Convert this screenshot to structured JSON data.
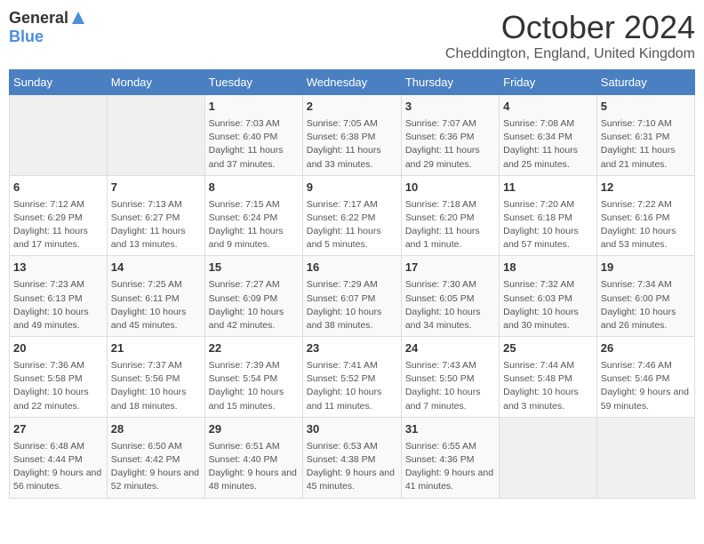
{
  "logo": {
    "general": "General",
    "blue": "Blue"
  },
  "title": "October 2024",
  "location": "Cheddington, England, United Kingdom",
  "days_of_week": [
    "Sunday",
    "Monday",
    "Tuesday",
    "Wednesday",
    "Thursday",
    "Friday",
    "Saturday"
  ],
  "weeks": [
    [
      {
        "day": "",
        "info": ""
      },
      {
        "day": "",
        "info": ""
      },
      {
        "day": "1",
        "sunrise": "Sunrise: 7:03 AM",
        "sunset": "Sunset: 6:40 PM",
        "daylight": "Daylight: 11 hours and 37 minutes."
      },
      {
        "day": "2",
        "sunrise": "Sunrise: 7:05 AM",
        "sunset": "Sunset: 6:38 PM",
        "daylight": "Daylight: 11 hours and 33 minutes."
      },
      {
        "day": "3",
        "sunrise": "Sunrise: 7:07 AM",
        "sunset": "Sunset: 6:36 PM",
        "daylight": "Daylight: 11 hours and 29 minutes."
      },
      {
        "day": "4",
        "sunrise": "Sunrise: 7:08 AM",
        "sunset": "Sunset: 6:34 PM",
        "daylight": "Daylight: 11 hours and 25 minutes."
      },
      {
        "day": "5",
        "sunrise": "Sunrise: 7:10 AM",
        "sunset": "Sunset: 6:31 PM",
        "daylight": "Daylight: 11 hours and 21 minutes."
      }
    ],
    [
      {
        "day": "6",
        "sunrise": "Sunrise: 7:12 AM",
        "sunset": "Sunset: 6:29 PM",
        "daylight": "Daylight: 11 hours and 17 minutes."
      },
      {
        "day": "7",
        "sunrise": "Sunrise: 7:13 AM",
        "sunset": "Sunset: 6:27 PM",
        "daylight": "Daylight: 11 hours and 13 minutes."
      },
      {
        "day": "8",
        "sunrise": "Sunrise: 7:15 AM",
        "sunset": "Sunset: 6:24 PM",
        "daylight": "Daylight: 11 hours and 9 minutes."
      },
      {
        "day": "9",
        "sunrise": "Sunrise: 7:17 AM",
        "sunset": "Sunset: 6:22 PM",
        "daylight": "Daylight: 11 hours and 5 minutes."
      },
      {
        "day": "10",
        "sunrise": "Sunrise: 7:18 AM",
        "sunset": "Sunset: 6:20 PM",
        "daylight": "Daylight: 11 hours and 1 minute."
      },
      {
        "day": "11",
        "sunrise": "Sunrise: 7:20 AM",
        "sunset": "Sunset: 6:18 PM",
        "daylight": "Daylight: 10 hours and 57 minutes."
      },
      {
        "day": "12",
        "sunrise": "Sunrise: 7:22 AM",
        "sunset": "Sunset: 6:16 PM",
        "daylight": "Daylight: 10 hours and 53 minutes."
      }
    ],
    [
      {
        "day": "13",
        "sunrise": "Sunrise: 7:23 AM",
        "sunset": "Sunset: 6:13 PM",
        "daylight": "Daylight: 10 hours and 49 minutes."
      },
      {
        "day": "14",
        "sunrise": "Sunrise: 7:25 AM",
        "sunset": "Sunset: 6:11 PM",
        "daylight": "Daylight: 10 hours and 45 minutes."
      },
      {
        "day": "15",
        "sunrise": "Sunrise: 7:27 AM",
        "sunset": "Sunset: 6:09 PM",
        "daylight": "Daylight: 10 hours and 42 minutes."
      },
      {
        "day": "16",
        "sunrise": "Sunrise: 7:29 AM",
        "sunset": "Sunset: 6:07 PM",
        "daylight": "Daylight: 10 hours and 38 minutes."
      },
      {
        "day": "17",
        "sunrise": "Sunrise: 7:30 AM",
        "sunset": "Sunset: 6:05 PM",
        "daylight": "Daylight: 10 hours and 34 minutes."
      },
      {
        "day": "18",
        "sunrise": "Sunrise: 7:32 AM",
        "sunset": "Sunset: 6:03 PM",
        "daylight": "Daylight: 10 hours and 30 minutes."
      },
      {
        "day": "19",
        "sunrise": "Sunrise: 7:34 AM",
        "sunset": "Sunset: 6:00 PM",
        "daylight": "Daylight: 10 hours and 26 minutes."
      }
    ],
    [
      {
        "day": "20",
        "sunrise": "Sunrise: 7:36 AM",
        "sunset": "Sunset: 5:58 PM",
        "daylight": "Daylight: 10 hours and 22 minutes."
      },
      {
        "day": "21",
        "sunrise": "Sunrise: 7:37 AM",
        "sunset": "Sunset: 5:56 PM",
        "daylight": "Daylight: 10 hours and 18 minutes."
      },
      {
        "day": "22",
        "sunrise": "Sunrise: 7:39 AM",
        "sunset": "Sunset: 5:54 PM",
        "daylight": "Daylight: 10 hours and 15 minutes."
      },
      {
        "day": "23",
        "sunrise": "Sunrise: 7:41 AM",
        "sunset": "Sunset: 5:52 PM",
        "daylight": "Daylight: 10 hours and 11 minutes."
      },
      {
        "day": "24",
        "sunrise": "Sunrise: 7:43 AM",
        "sunset": "Sunset: 5:50 PM",
        "daylight": "Daylight: 10 hours and 7 minutes."
      },
      {
        "day": "25",
        "sunrise": "Sunrise: 7:44 AM",
        "sunset": "Sunset: 5:48 PM",
        "daylight": "Daylight: 10 hours and 3 minutes."
      },
      {
        "day": "26",
        "sunrise": "Sunrise: 7:46 AM",
        "sunset": "Sunset: 5:46 PM",
        "daylight": "Daylight: 9 hours and 59 minutes."
      }
    ],
    [
      {
        "day": "27",
        "sunrise": "Sunrise: 6:48 AM",
        "sunset": "Sunset: 4:44 PM",
        "daylight": "Daylight: 9 hours and 56 minutes."
      },
      {
        "day": "28",
        "sunrise": "Sunrise: 6:50 AM",
        "sunset": "Sunset: 4:42 PM",
        "daylight": "Daylight: 9 hours and 52 minutes."
      },
      {
        "day": "29",
        "sunrise": "Sunrise: 6:51 AM",
        "sunset": "Sunset: 4:40 PM",
        "daylight": "Daylight: 9 hours and 48 minutes."
      },
      {
        "day": "30",
        "sunrise": "Sunrise: 6:53 AM",
        "sunset": "Sunset: 4:38 PM",
        "daylight": "Daylight: 9 hours and 45 minutes."
      },
      {
        "day": "31",
        "sunrise": "Sunrise: 6:55 AM",
        "sunset": "Sunset: 4:36 PM",
        "daylight": "Daylight: 9 hours and 41 minutes."
      },
      {
        "day": "",
        "info": ""
      },
      {
        "day": "",
        "info": ""
      }
    ]
  ]
}
